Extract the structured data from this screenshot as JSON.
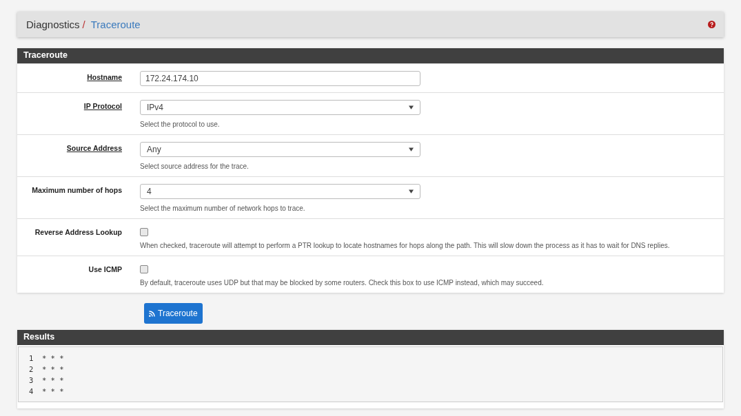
{
  "breadcrumb": {
    "parent": "Diagnostics",
    "separator": "/",
    "current": "Traceroute"
  },
  "panel": {
    "title": "Traceroute",
    "fields": [
      {
        "kind": "text",
        "label": "Hostname",
        "link": true,
        "value": "172.24.174.10"
      },
      {
        "kind": "select",
        "label": "IP Protocol",
        "link": true,
        "value": "IPv4",
        "help": "Select the protocol to use."
      },
      {
        "kind": "select",
        "label": "Source Address",
        "link": true,
        "value": "Any",
        "help": "Select source address for the trace."
      },
      {
        "kind": "select",
        "label": "Maximum number of hops",
        "link": false,
        "value": "4",
        "help": "Select the maximum number of network hops to trace."
      },
      {
        "kind": "checkbox",
        "label": "Reverse Address Lookup",
        "link": false,
        "checked": false,
        "help": "When checked, traceroute will attempt to perform a PTR lookup to locate hostnames for hops along the path. This will slow down the process as it has to wait for DNS replies."
      },
      {
        "kind": "checkbox",
        "label": "Use ICMP",
        "link": false,
        "checked": false,
        "help": "By default, traceroute uses UDP but that may be blocked by some routers. Check this box to use ICMP instead, which may succeed."
      }
    ]
  },
  "button": {
    "label": "Traceroute"
  },
  "results": {
    "title": "Results",
    "lines": [
      "1  * * *",
      "2  * * *",
      "3  * * *",
      "4  * * *"
    ]
  }
}
